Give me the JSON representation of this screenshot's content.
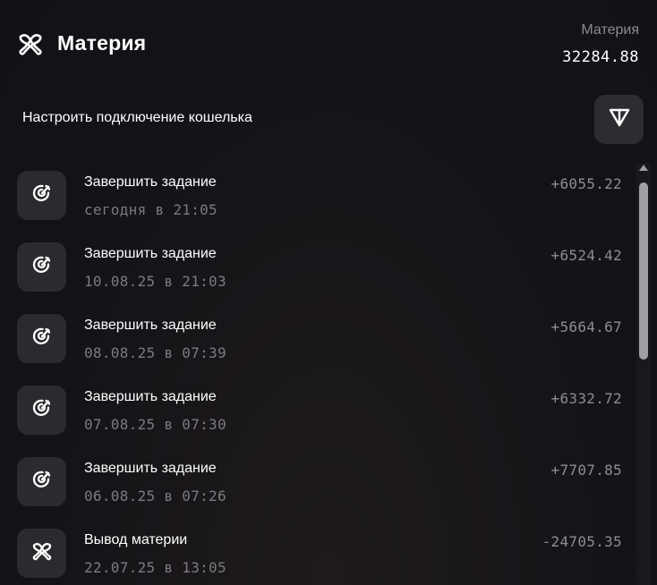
{
  "header": {
    "title": "Материя",
    "logo_icon": "matter-logo-icon",
    "balance_label": "Материя",
    "balance_value": "32284.88"
  },
  "wallet": {
    "label": "Настроить подключение кошелька",
    "button_icon": "ton-icon"
  },
  "transactions": [
    {
      "title": "Завершить задание",
      "date": "сегодня в 21:05",
      "amount": "+6055.22",
      "icon": "target-icon"
    },
    {
      "title": "Завершить задание",
      "date": "10.08.25 в 21:03",
      "amount": "+6524.42",
      "icon": "target-icon"
    },
    {
      "title": "Завершить задание",
      "date": "08.08.25 в 07:39",
      "amount": "+5664.67",
      "icon": "target-icon"
    },
    {
      "title": "Завершить задание",
      "date": "07.08.25 в 07:30",
      "amount": "+6332.72",
      "icon": "target-icon"
    },
    {
      "title": "Завершить задание",
      "date": "06.08.25 в 07:26",
      "amount": "+7707.85",
      "icon": "target-icon"
    },
    {
      "title": "Вывод материи",
      "date": "22.07.25 в 13:05",
      "amount": "-24705.35",
      "icon": "matter-logo-icon"
    }
  ]
}
